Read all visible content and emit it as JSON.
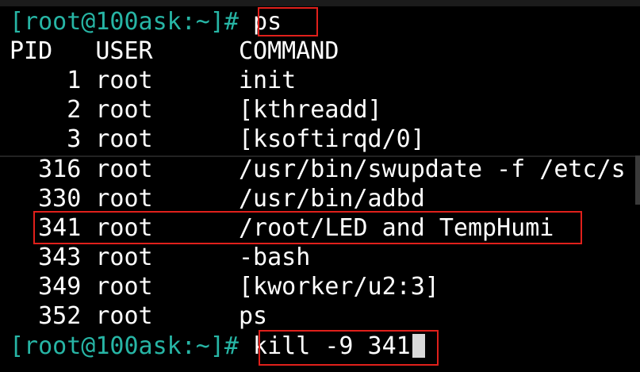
{
  "terminal": {
    "prompt": "[root@100ask:~]#",
    "first_command": "ps",
    "last_command": "kill -9 341",
    "header": "PID   USER      COMMAND",
    "rows": [
      "    1 root      init",
      "    2 root      [kthreadd]",
      "    3 root      [ksoftirqd/0]",
      "  316 root      /usr/bin/swupdate -f /etc/s",
      "  330 root      /usr/bin/adbd",
      "  341 root      /root/LED and TempHumi",
      "  343 root      -bash",
      "  349 root      [kworker/u2:3]",
      "  352 root      ps"
    ]
  },
  "colors": {
    "background": "#000000",
    "prompt": "#27b5a5",
    "text": "#ffffff",
    "highlight": "#e0201b"
  }
}
